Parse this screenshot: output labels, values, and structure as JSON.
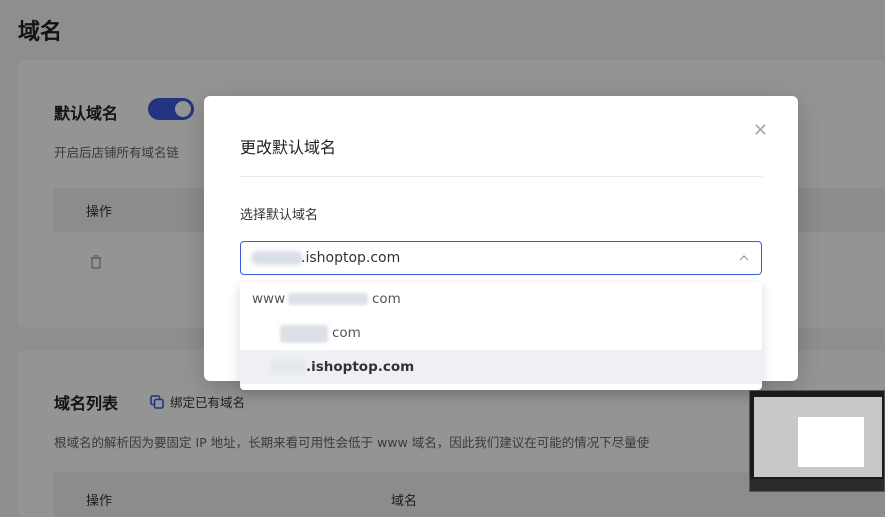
{
  "page": {
    "title": "域名"
  },
  "default_domain": {
    "title": "默认域名",
    "description": "开启后店铺所有域名链",
    "table": {
      "col_action": "操作"
    },
    "toggle_on": true
  },
  "domain_list": {
    "title": "域名列表",
    "bind_label": "绑定已有域名",
    "description": "根域名的解析因为要固定 IP 地址，长期来看可用性会低于 www 域名，因此我们建议在可能的情况下尽量使",
    "table": {
      "col_action": "操作",
      "col_domain": "域名"
    }
  },
  "modal": {
    "title": "更改默认域名",
    "field_label": "选择默认域名",
    "selected_value": ".ishoptop.com",
    "options": [
      {
        "prefix": "www",
        "suffix": "com"
      },
      {
        "prefix": "",
        "suffix": "com"
      },
      {
        "prefix": "",
        "suffix": ".ishoptop.com"
      }
    ]
  },
  "icons": {
    "close": "close-icon",
    "chevron": "chevron-up-icon",
    "trash": "trash-icon",
    "copy": "copy-icon"
  },
  "colors": {
    "accent": "#3b5bdb",
    "overlay": "rgba(0,0,0,0.42)"
  }
}
